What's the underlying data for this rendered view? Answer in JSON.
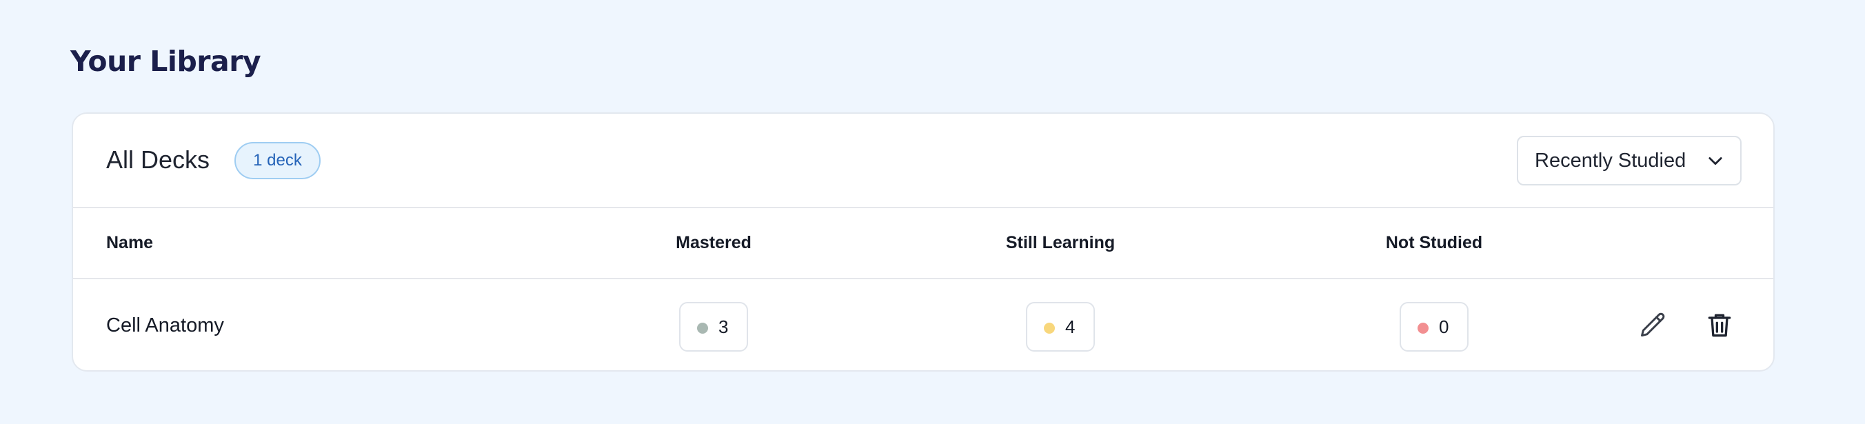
{
  "page": {
    "title": "Your Library"
  },
  "card": {
    "title": "All Decks",
    "deck_count": "1 deck",
    "sort": {
      "selected": "Recently Studied",
      "icon": "chevron-down-icon"
    }
  },
  "table": {
    "columns": {
      "name": "Name",
      "mastered": "Mastered",
      "learning": "Still Learning",
      "not_studied": "Not Studied"
    },
    "rows": [
      {
        "name": "Cell Anatomy",
        "mastered": "3",
        "learning": "4",
        "not_studied": "0",
        "actions": [
          "pencil-icon",
          "trash-icon"
        ]
      }
    ]
  },
  "colors": {
    "background": "#eff6fe",
    "title": "#1b1f4b",
    "badge_text": "#2563b8",
    "mastered_dot": "#a9b8b2",
    "learning_dot": "#f8d77c",
    "not_studied_dot": "#f28f91"
  }
}
